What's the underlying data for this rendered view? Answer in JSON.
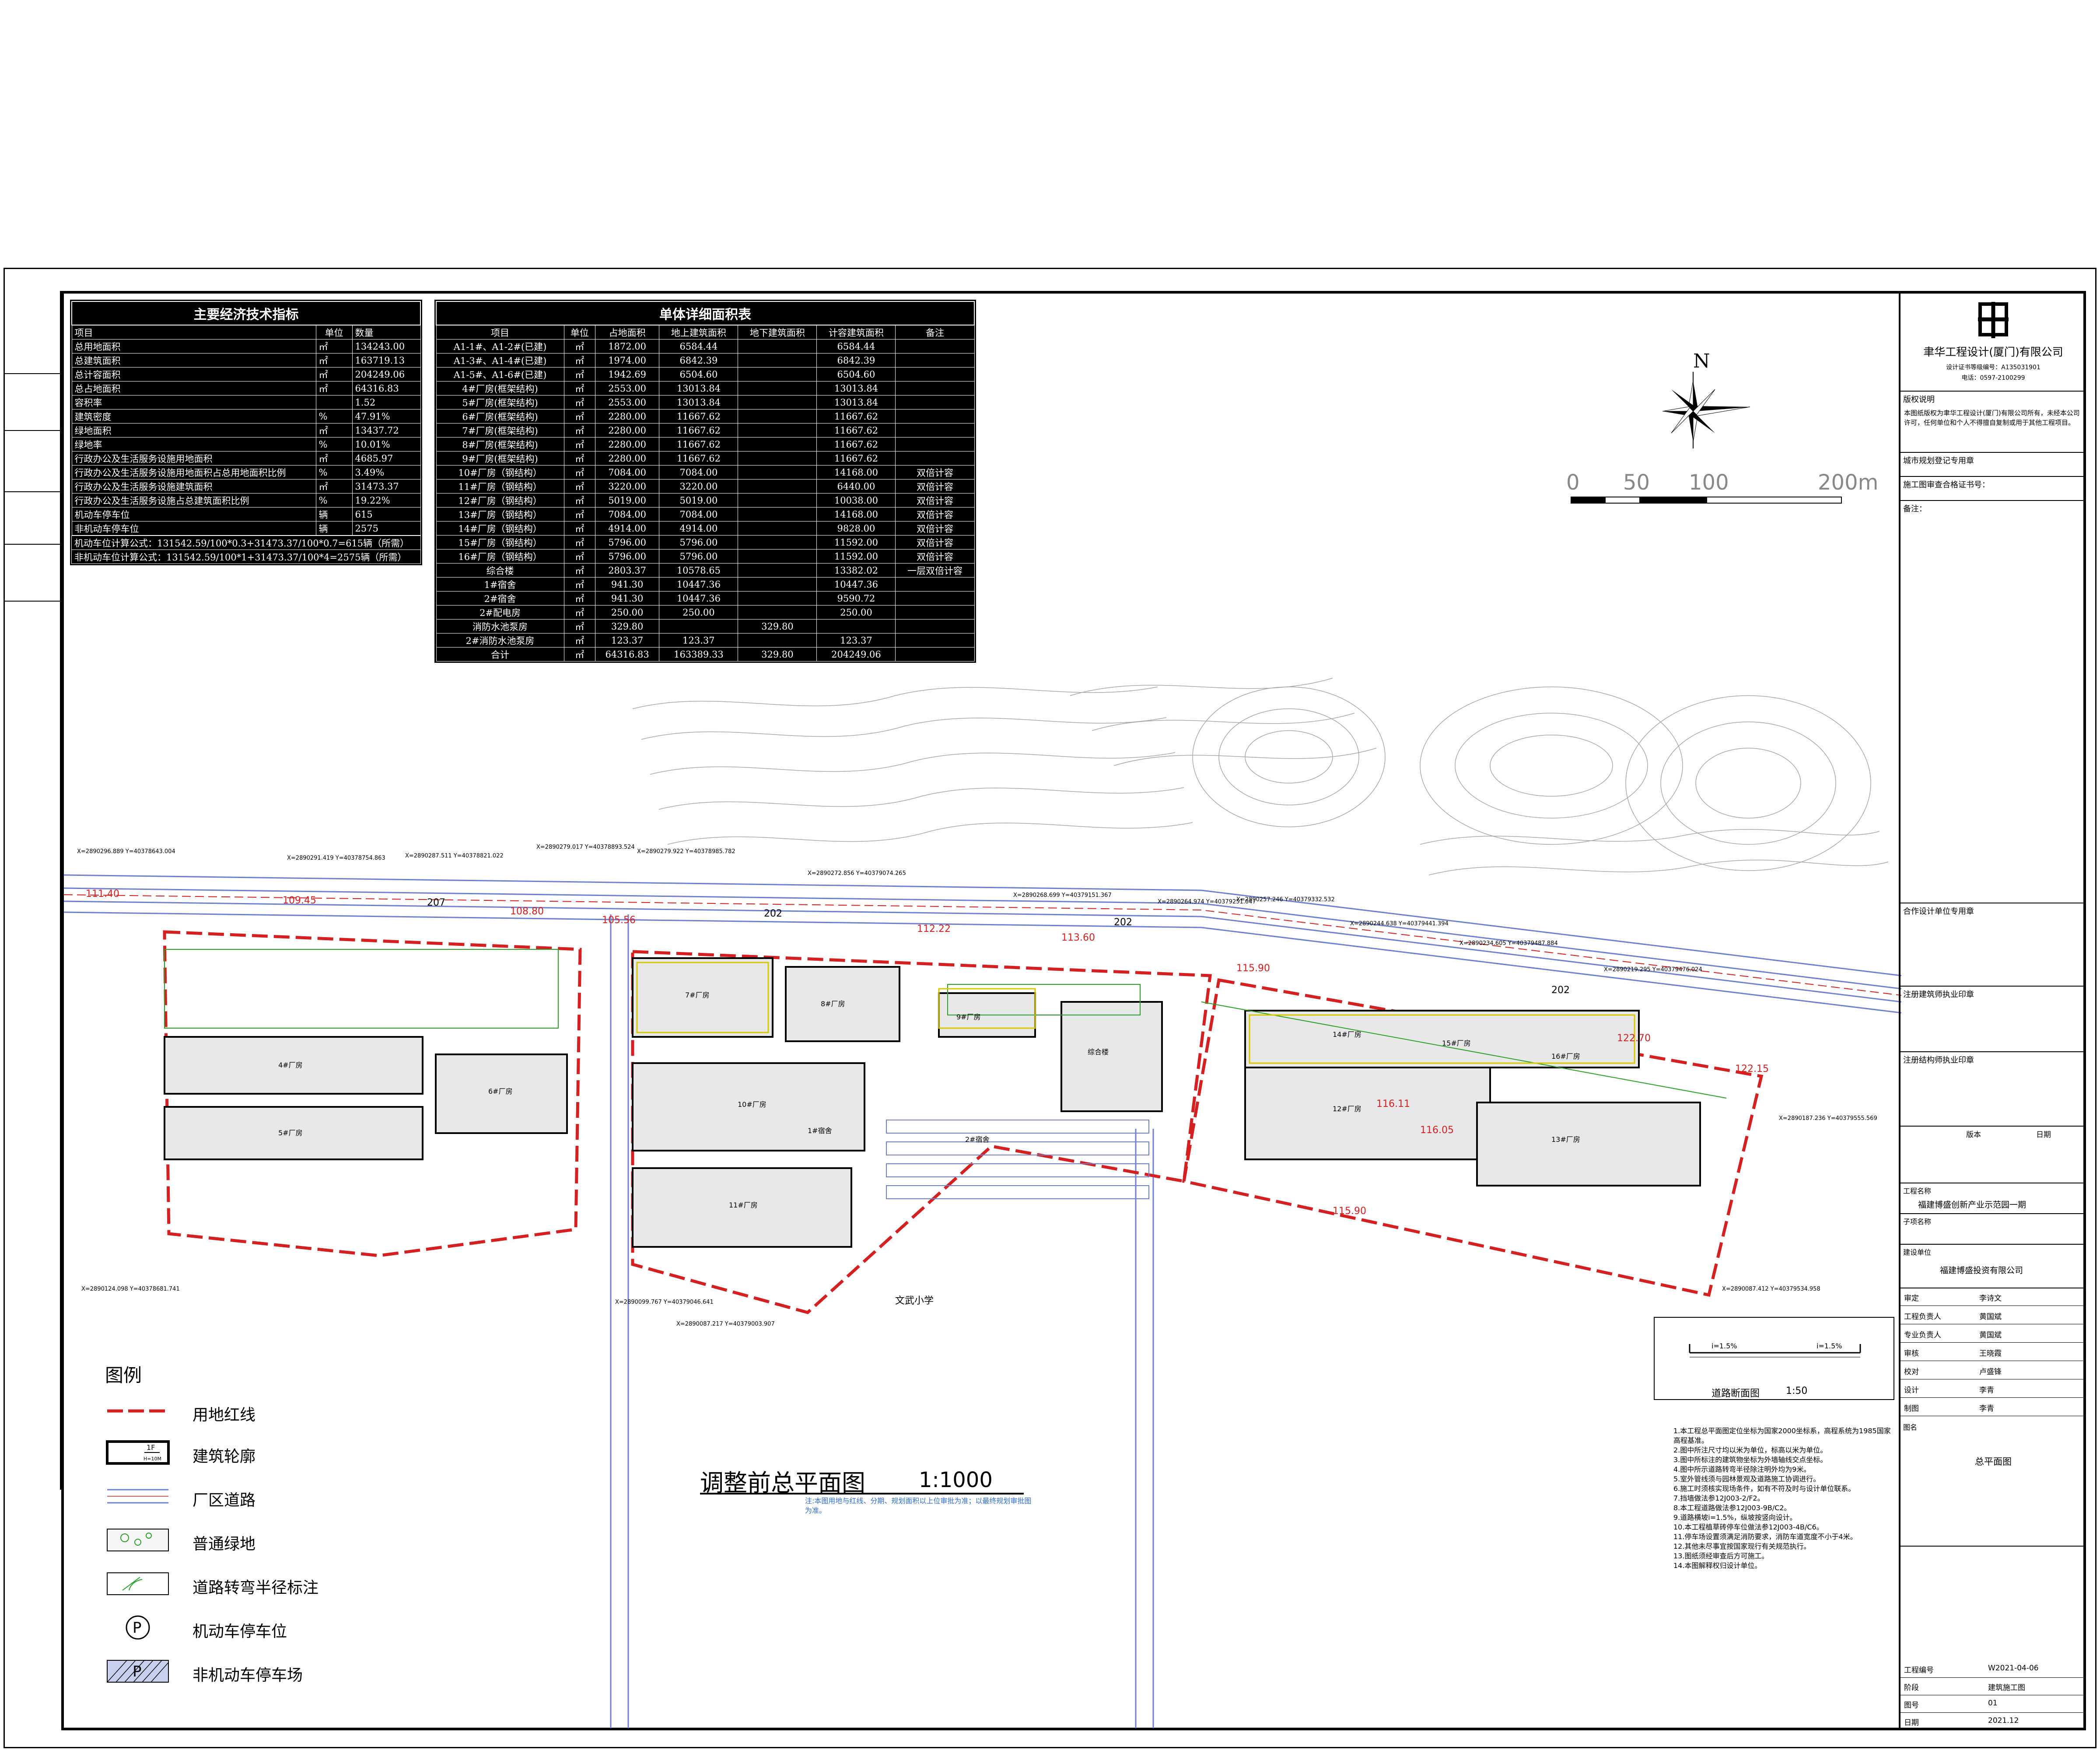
{
  "econ_table": {
    "title": "主要经济技术指标",
    "headers": [
      "项目",
      "单位",
      "数量"
    ],
    "rows": [
      [
        "总用地面积",
        "㎡",
        "134243.00"
      ],
      [
        "总建筑面积",
        "㎡",
        "163719.13"
      ],
      [
        "总计容面积",
        "㎡",
        "204249.06"
      ],
      [
        "总占地面积",
        "㎡",
        "64316.83"
      ],
      [
        "容积率",
        "",
        "1.52"
      ],
      [
        "建筑密度",
        "%",
        "47.91%"
      ],
      [
        "绿地面积",
        "㎡",
        "13437.72"
      ],
      [
        "绿地率",
        "%",
        "10.01%"
      ],
      [
        "行政办公及生活服务设施用地面积",
        "㎡",
        "4685.97"
      ],
      [
        "行政办公及生活服务设施用地面积占总用地面积比例",
        "%",
        "3.49%"
      ],
      [
        "行政办公及生活服务设施建筑面积",
        "㎡",
        "31473.37"
      ],
      [
        "行政办公及生活服务设施占总建筑面积比例",
        "%",
        "19.22%"
      ],
      [
        "机动车停车位",
        "辆",
        "615"
      ],
      [
        "非机动车停车位",
        "辆",
        "2575"
      ]
    ],
    "formulas": [
      "机动车位计算公式：131542.59/100*0.3+31473.37/100*0.7=615辆（所需）",
      "非机动车位计算公式：131542.59/100*1+31473.37/100*4=2575辆（所需）"
    ]
  },
  "area_table": {
    "title": "单体详细面积表",
    "headers": [
      "项目",
      "单位",
      "占地面积",
      "地上建筑面积",
      "地下建筑面积",
      "计容建筑面积",
      "备注"
    ],
    "rows": [
      [
        "A1-1#、A1-2#(已建)",
        "㎡",
        "1872.00",
        "6584.44",
        "",
        "6584.44",
        ""
      ],
      [
        "A1-3#、A1-4#(已建)",
        "㎡",
        "1974.00",
        "6842.39",
        "",
        "6842.39",
        ""
      ],
      [
        "A1-5#、A1-6#(已建)",
        "㎡",
        "1942.69",
        "6504.60",
        "",
        "6504.60",
        ""
      ],
      [
        "4#厂房(框架结构)",
        "㎡",
        "2553.00",
        "13013.84",
        "",
        "13013.84",
        ""
      ],
      [
        "5#厂房(框架结构)",
        "㎡",
        "2553.00",
        "13013.84",
        "",
        "13013.84",
        ""
      ],
      [
        "6#厂房(框架结构)",
        "㎡",
        "2280.00",
        "11667.62",
        "",
        "11667.62",
        ""
      ],
      [
        "7#厂房(框架结构)",
        "㎡",
        "2280.00",
        "11667.62",
        "",
        "11667.62",
        ""
      ],
      [
        "8#厂房(框架结构)",
        "㎡",
        "2280.00",
        "11667.62",
        "",
        "11667.62",
        ""
      ],
      [
        "9#厂房(框架结构)",
        "㎡",
        "2280.00",
        "11667.62",
        "",
        "11667.62",
        ""
      ],
      [
        "10#厂房（钢结构）",
        "㎡",
        "7084.00",
        "7084.00",
        "",
        "14168.00",
        "双倍计容"
      ],
      [
        "11#厂房（钢结构）",
        "㎡",
        "3220.00",
        "3220.00",
        "",
        "6440.00",
        "双倍计容"
      ],
      [
        "12#厂房（钢结构）",
        "㎡",
        "5019.00",
        "5019.00",
        "",
        "10038.00",
        "双倍计容"
      ],
      [
        "13#厂房（钢结构）",
        "㎡",
        "7084.00",
        "7084.00",
        "",
        "14168.00",
        "双倍计容"
      ],
      [
        "14#厂房（钢结构）",
        "㎡",
        "4914.00",
        "4914.00",
        "",
        "9828.00",
        "双倍计容"
      ],
      [
        "15#厂房（钢结构）",
        "㎡",
        "5796.00",
        "5796.00",
        "",
        "11592.00",
        "双倍计容"
      ],
      [
        "16#厂房（钢结构）",
        "㎡",
        "5796.00",
        "5796.00",
        "",
        "11592.00",
        "双倍计容"
      ],
      [
        "综合楼",
        "㎡",
        "2803.37",
        "10578.65",
        "",
        "13382.02",
        "一层双倍计容"
      ],
      [
        "1#宿舍",
        "㎡",
        "941.30",
        "10447.36",
        "",
        "10447.36",
        ""
      ],
      [
        "2#宿舍",
        "㎡",
        "941.30",
        "10447.36",
        "",
        "9590.72",
        ""
      ],
      [
        "2#配电房",
        "㎡",
        "250.00",
        "250.00",
        "",
        "250.00",
        ""
      ],
      [
        "消防水池泵房",
        "㎡",
        "329.80",
        "",
        "329.80",
        "",
        ""
      ],
      [
        "2#消防水池泵房",
        "㎡",
        "123.37",
        "123.37",
        "",
        "123.37",
        ""
      ],
      [
        "合计",
        "㎡",
        "64316.83",
        "163389.33",
        "329.80",
        "204249.06",
        ""
      ]
    ]
  },
  "compass": {
    "north_label": "N"
  },
  "scalebar": {
    "ticks": [
      "0",
      "50",
      "100",
      "200m"
    ]
  },
  "map": {
    "title": "调整前总平面图",
    "scale": "1:1000",
    "note": "注:本图用地与红线、分期、规划面积以上位审批为准；以最终规划审批图为准。",
    "road_labels": [
      "202",
      "202",
      "202",
      "207"
    ],
    "elevations": [
      "111.40",
      "109.45",
      "108.80",
      "105.56",
      "112.22",
      "113.60",
      "115.90",
      "122.70",
      "122.15",
      "116.11",
      "116.05",
      "115.90"
    ],
    "building_labels": [
      "4#厂房",
      "5#厂房",
      "6#厂房",
      "7#厂房",
      "8#厂房",
      "9#厂房",
      "10#厂房",
      "11#厂房",
      "12#厂房",
      "13#厂房",
      "14#厂房",
      "15#厂房",
      "16#厂房",
      "综合楼",
      "1#宿舍",
      "2#宿舍"
    ],
    "coords": [
      "X=2890296.889 Y=40378643.004",
      "X=2890291.419 Y=40378754.863",
      "X=2890287.511 Y=40378821.022",
      "X=2890279.017 Y=40378893.524",
      "X=2890279.922 Y=40378985.782",
      "X=2890272.856 Y=40379074.265",
      "X=2890268.699 Y=40379151.367",
      "X=2890264.974 Y=40379251.047",
      "X=2890257.246 Y=40379332.532",
      "X=2890244.638 Y=40379441.394",
      "X=2890234.605 Y=40379487.884",
      "X=2890219.295 Y=40379476.024",
      "X=2890187.236 Y=40379555.569",
      "X=2890087.412 Y=40379534.958",
      "X=2890099.767 Y=40379046.641",
      "X=2890087.217 Y=40379003.907",
      "X=2890124.098 Y=40378681.741"
    ],
    "place_label": "文武小学"
  },
  "legend": {
    "title": "图例",
    "items": [
      {
        "label": "用地红线",
        "icon": "red-line-icon"
      },
      {
        "label": "建筑轮廓",
        "icon": "building-outline-icon"
      },
      {
        "label": "厂区道路",
        "icon": "road-icon"
      },
      {
        "label": "普通绿地",
        "icon": "green-space-icon"
      },
      {
        "label": "道路转弯半径标注",
        "icon": "turn-radius-icon"
      },
      {
        "label": "机动车停车位",
        "icon": "parking-icon"
      },
      {
        "label": "非机动车停车场",
        "icon": "bike-parking-icon"
      }
    ],
    "building_tag_top": "1F",
    "building_tag_bottom": "H=10M",
    "parking_letter": "P"
  },
  "road_section": {
    "title": "道路断面图",
    "scale": "1:50",
    "slope_left": "i=1.5%",
    "slope_right": "i=1.5%"
  },
  "title_block": {
    "company": "聿华工程设计(厦门)有限公司",
    "license": "设计证书等级编号：A135031901",
    "phone": "电话：0597-2100299",
    "statement_title": "版权说明",
    "statement": "本图纸版权为聿华工程设计(厦门)有限公司所有，未经本公司许可，任何单位和个人不得擅自复制或用于其他工程项目。",
    "field_reg": "城市规划登记专用章",
    "field_review": "施工图审查合格证书号：",
    "field_remark": "备注：",
    "field_arch": "合作设计单位专用章",
    "field_struct": "注册建筑师执业印章",
    "field_mep": "注册结构师执业印章",
    "revision_headers": [
      "版本",
      "日期"
    ],
    "project_label": "工程名称",
    "project_name": "福建博盛创新产业示范园一期",
    "subitem_label": "子项名称",
    "client_label": "建设单位",
    "client_name": "福建博盛投资有限公司",
    "signatures": [
      [
        "审定",
        "李诗文"
      ],
      [
        "工程负责人",
        "黄国斌"
      ],
      [
        "专业负责人",
        "黄国斌"
      ],
      [
        "审核",
        "王晓霞"
      ],
      [
        "校对",
        "卢盛锋"
      ],
      [
        "设计",
        "李青"
      ],
      [
        "制图",
        "李青"
      ]
    ],
    "drawing_name_label": "图名",
    "drawing_name": "总平面图",
    "meta": [
      [
        "工程编号",
        "W2021-04-06"
      ],
      [
        "阶段",
        "建筑施工图"
      ],
      [
        "图号",
        "01"
      ],
      [
        "日期",
        "2021.12"
      ]
    ]
  },
  "notes": {
    "lines": [
      "1.本工程总平面图定位坐标为国家2000坐标系，高程系统为1985国家高程基准。",
      "2.图中所注尺寸均以米为单位，标高以米为单位。",
      "3.图中所标注的建筑物坐标为外墙轴线交点坐标。",
      "4.图中所示道路转弯半径除注明外均为9米。",
      "5.室外管线须与园林景观及道路施工协调进行。",
      "6.施工时须核实现场条件，如有不符及时与设计单位联系。",
      "7.挡墙做法参12J003-2/F2。",
      "8.本工程道路做法参12J003-9B/C2。",
      "9.道路横坡i=1.5%，纵坡按竖向设计。",
      "10.本工程植草砖停车位做法参12J003-4B/C6。",
      "11.停车场设置须满足消防要求，消防车道宽度不小于4米。",
      "12.其他未尽事宜按国家现行有关规范执行。",
      "13.图纸须经审查后方可施工。",
      "14.本图解释权归设计单位。"
    ]
  },
  "colors": {
    "red_line": "#d42020",
    "road_blue": "#7080d0",
    "green": "#28a028",
    "yellow": "#d8c800",
    "contour": "#a8a8a8",
    "building": "#000000"
  }
}
